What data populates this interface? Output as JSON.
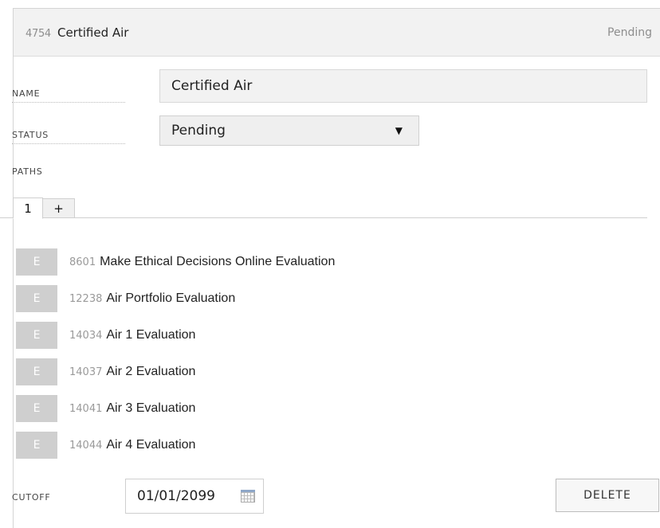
{
  "header": {
    "id": "4754",
    "name": "Certified Air",
    "status": "Pending"
  },
  "fields": {
    "name_label": "NAME",
    "name_value": "Certified Air",
    "status_label": "STATUS",
    "status_value": "Pending",
    "paths_label": "PATHS"
  },
  "tabs": [
    {
      "label": "1",
      "active": true
    },
    {
      "label": "+",
      "active": false
    }
  ],
  "paths": [
    {
      "badge": "E",
      "id": "8601",
      "title": "Make Ethical Decisions Online Evaluation"
    },
    {
      "badge": "E",
      "id": "12238",
      "title": "Air Portfolio Evaluation"
    },
    {
      "badge": "E",
      "id": "14034",
      "title": "Air 1 Evaluation"
    },
    {
      "badge": "E",
      "id": "14037",
      "title": "Air 2 Evaluation"
    },
    {
      "badge": "E",
      "id": "14041",
      "title": "Air 3 Evaluation"
    },
    {
      "badge": "E",
      "id": "14044",
      "title": "Air 4 Evaluation"
    }
  ],
  "footer": {
    "cutoff_label": "CUTOFF",
    "cutoff_date": "01/01/2099",
    "delete_label": "DELETE"
  }
}
